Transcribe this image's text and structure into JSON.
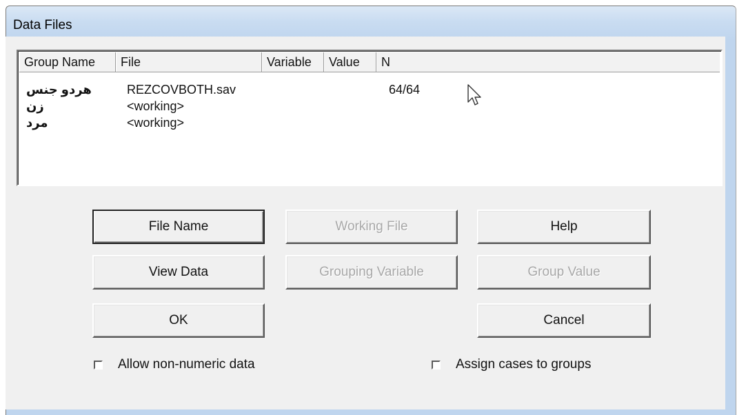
{
  "window": {
    "title": "Data Files"
  },
  "list": {
    "columns": [
      "Group Name",
      "File",
      "Variable",
      "Value",
      "N"
    ],
    "rows": [
      {
        "group": "هردو جنس",
        "file": "REZCOVBOTH.sav",
        "variable": "",
        "value": "",
        "n": "64/64"
      },
      {
        "group": "زن",
        "file": "<working>",
        "variable": "",
        "value": "",
        "n": ""
      },
      {
        "group": "مرد",
        "file": "<working>",
        "variable": "",
        "value": "",
        "n": ""
      }
    ]
  },
  "buttons": {
    "file_name": "File Name",
    "working_file": "Working File",
    "help": "Help",
    "view_data": "View Data",
    "grouping_variable": "Grouping Variable",
    "group_value": "Group Value",
    "ok": "OK",
    "cancel": "Cancel"
  },
  "checkboxes": {
    "allow_non_numeric": {
      "label": "Allow non-numeric data",
      "checked": false
    },
    "assign_cases": {
      "label": "Assign cases to groups",
      "checked": false
    }
  },
  "icons": [
    "mouse-pointer-icon"
  ]
}
